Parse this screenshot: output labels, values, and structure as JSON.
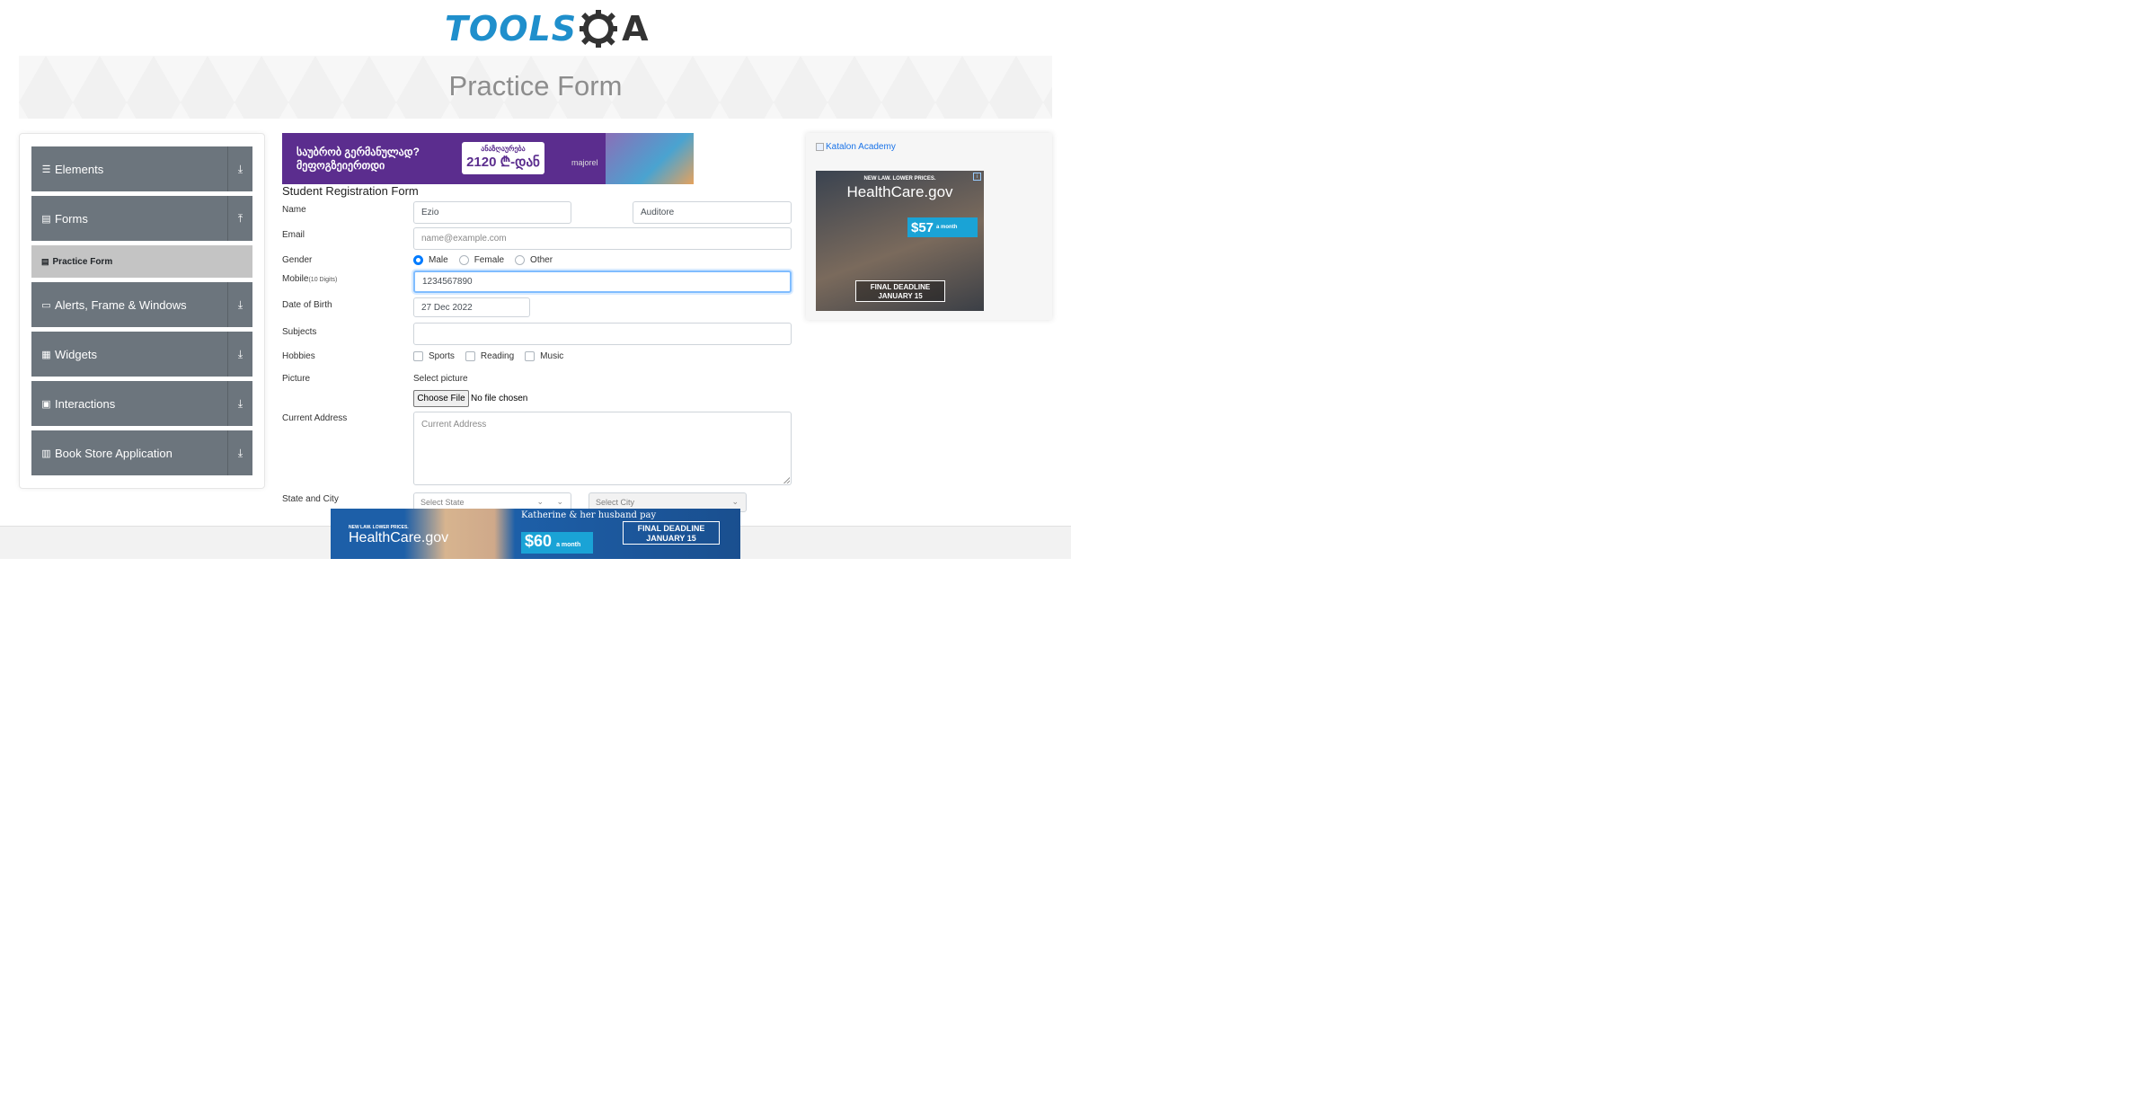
{
  "logo": {
    "tools": "TOOLS",
    "qa": "A"
  },
  "page_title": "Practice Form",
  "sidebar": {
    "groups": [
      {
        "label": "Elements",
        "icon": "list-icon"
      },
      {
        "label": "Forms",
        "icon": "document-icon"
      },
      {
        "label": "Alerts, Frame & Windows",
        "icon": "window-icon"
      },
      {
        "label": "Widgets",
        "icon": "grid-icon"
      },
      {
        "label": "Interactions",
        "icon": "interactions-icon"
      },
      {
        "label": "Book Store Application",
        "icon": "book-icon"
      }
    ],
    "active_item": "Practice Form"
  },
  "ad_top": {
    "headline": "საუბრობ გერმანულად? მეფოგზეიერთდი",
    "box_line1": "ანაზღაურება",
    "box_line2": "2120 ₾-დან",
    "brand": "majorel"
  },
  "form": {
    "title": "Student Registration Form",
    "labels": {
      "name": "Name",
      "email": "Email",
      "gender": "Gender",
      "mobile": "Mobile",
      "mobile_hint": "(10 Digits)",
      "dob": "Date of Birth",
      "subjects": "Subjects",
      "hobbies": "Hobbies",
      "picture": "Picture",
      "address": "Current Address",
      "state_city": "State and City"
    },
    "first_name": "Ezio",
    "last_name": "Auditore",
    "email_placeholder": "name@example.com",
    "gender_options": [
      "Male",
      "Female",
      "Other"
    ],
    "gender_selected": "Male",
    "mobile": "1234567890",
    "dob": "27 Dec 2022",
    "subjects": "",
    "hobbies": [
      "Sports",
      "Reading",
      "Music"
    ],
    "picture_label": "Select picture",
    "choose_file": "Choose File",
    "no_file": "No file chosen",
    "address_placeholder": "Current Address",
    "state_placeholder": "Select State",
    "city_placeholder": "Select City"
  },
  "right_ads": {
    "broken_image_alt": "Katalon Academy",
    "healthcare": {
      "kicker": "NEW LAW. LOWER PRICES.",
      "brand": "HealthCare.gov",
      "price": "$57",
      "price_suffix": "a month",
      "deadline": "FINAL DEADLINE JANUARY 15"
    }
  },
  "bottom_ad": {
    "kicker": "NEW LAW. LOWER PRICES.",
    "brand": "HealthCare.gov",
    "tagline": "Katherine & her husband pay",
    "price": "$60",
    "price_suffix": "a month",
    "deadline": "FINAL DEADLINE JANUARY 15"
  },
  "colors": {
    "logo_blue": "#1f8fcc",
    "sidebar_group": "#6c757d",
    "sidebar_active": "#c4c4c4",
    "radio_active": "#007bff",
    "focus_border": "#80bdff"
  }
}
